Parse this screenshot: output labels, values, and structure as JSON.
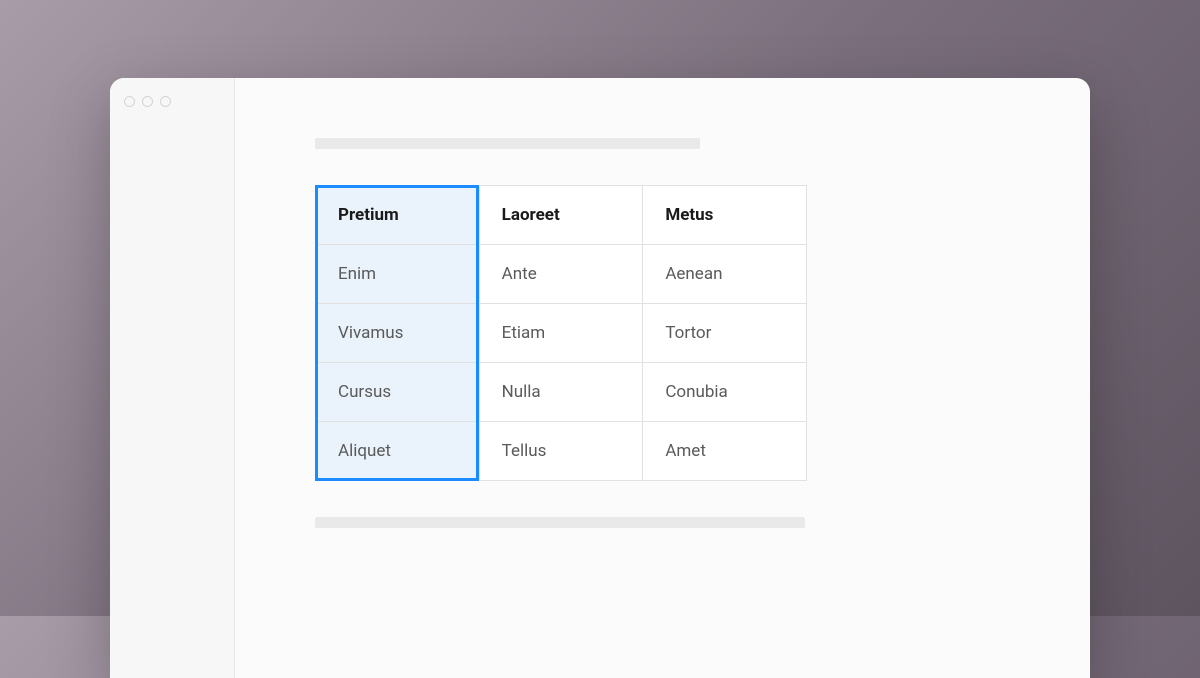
{
  "table": {
    "headers": [
      "Pretium",
      "Laoreet",
      "Metus"
    ],
    "rows": [
      [
        "Enim",
        "Ante",
        "Aenean"
      ],
      [
        "Vivamus",
        "Etiam",
        "Tortor"
      ],
      [
        "Cursus",
        "Nulla",
        "Conubia"
      ],
      [
        "Aliquet",
        "Tellus",
        "Amet"
      ]
    ],
    "selected_column_index": 0
  }
}
